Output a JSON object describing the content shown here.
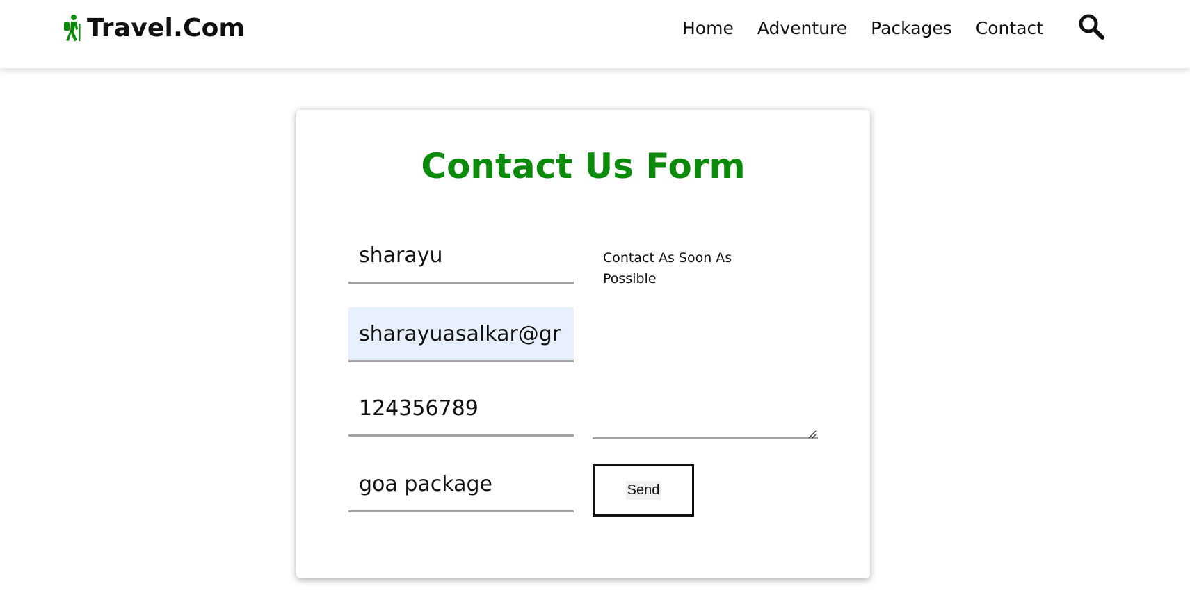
{
  "header": {
    "brand": "Travel.Com",
    "brand_icon": "hiker-icon",
    "nav": [
      {
        "label": "Home"
      },
      {
        "label": "Adventure"
      },
      {
        "label": "Packages"
      },
      {
        "label": "Contact"
      }
    ],
    "search_icon": "search-icon"
  },
  "form": {
    "title": "Contact Us Form",
    "name_value": "sharayu",
    "email_value": "sharayuasalkar@gr",
    "phone_value": "124356789",
    "subject_value": "goa package",
    "message_value": "Contact As Soon As Possible",
    "send_label": "Send"
  },
  "colors": {
    "accent": "#0c8a0c",
    "autofill": "#e8f0fd",
    "underline": "#a3a3a3"
  }
}
